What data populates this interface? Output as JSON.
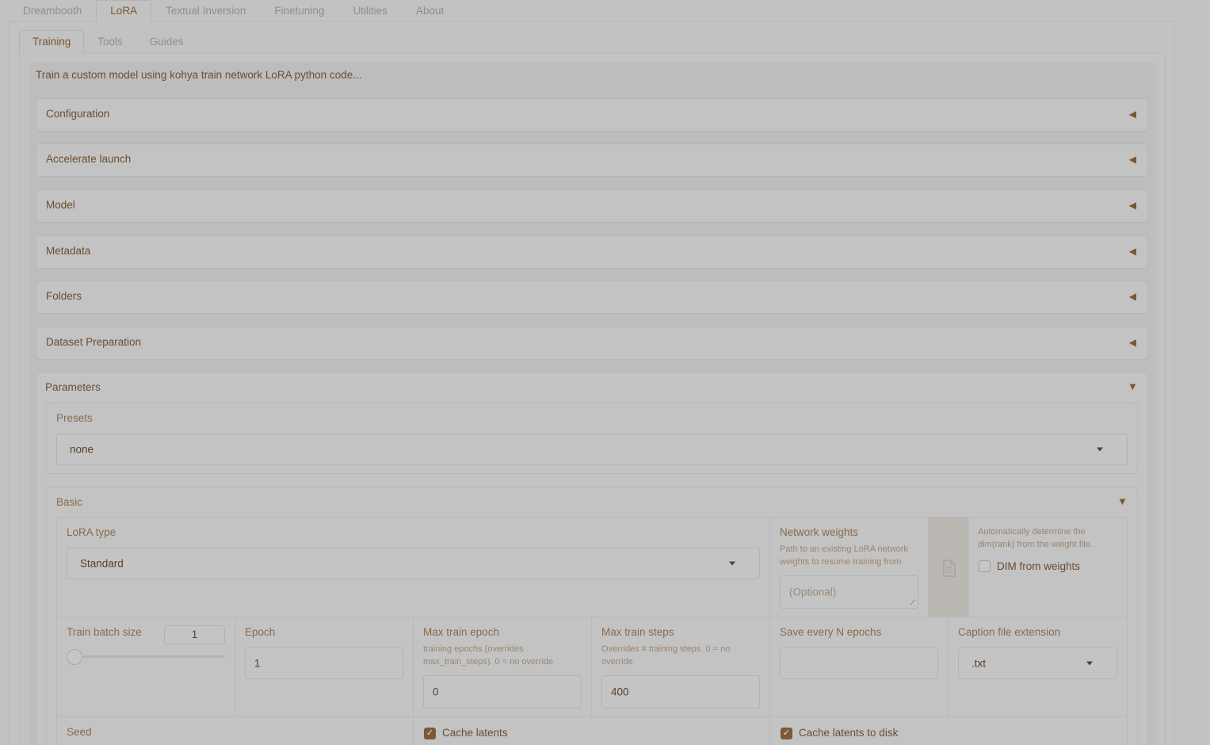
{
  "top_tabs": [
    "Dreambooth",
    "LoRA",
    "Textual Inversion",
    "Finetuning",
    "Utilities",
    "About"
  ],
  "sub_tabs": [
    "Training",
    "Tools",
    "Guides"
  ],
  "description": "Train a custom model using kohya train network LoRA python code...",
  "accordions": [
    "Configuration",
    "Accelerate launch",
    "Model",
    "Metadata",
    "Folders",
    "Dataset Preparation"
  ],
  "parameters": {
    "title": "Parameters",
    "presets_label": "Presets",
    "presets_value": "none",
    "basic_title": "Basic",
    "lora_type_label": "LoRA type",
    "lora_type_value": "Standard",
    "network_weights_label": "Network weights",
    "network_weights_info": "Path to an existing LoRA network weights to resume training from",
    "network_weights_placeholder": "(Optional)",
    "dim_info": "Automatically determine the dim(rank) from the weight file.",
    "dim_from_weights_label": "DIM from weights",
    "train_batch_label": "Train batch size",
    "train_batch_value": "1",
    "epoch_label": "Epoch",
    "epoch_value": "1",
    "max_train_epoch_label": "Max train epoch",
    "max_train_epoch_info": "training epochs (overrides max_train_steps). 0 = no override",
    "max_train_epoch_value": "0",
    "max_train_steps_label": "Max train steps",
    "max_train_steps_info": "Overrides # training steps. 0 = no override",
    "max_train_steps_value": "400",
    "save_every_label": "Save every N epochs",
    "save_every_value": "",
    "caption_ext_label": "Caption file extension",
    "caption_ext_value": ".txt",
    "seed_label": "Seed",
    "cache_latents_label": "Cache latents",
    "cache_latents_disk_label": "Cache latents to disk"
  },
  "colors": {
    "accent": "#7a5630",
    "background": "#c2c2c2"
  }
}
